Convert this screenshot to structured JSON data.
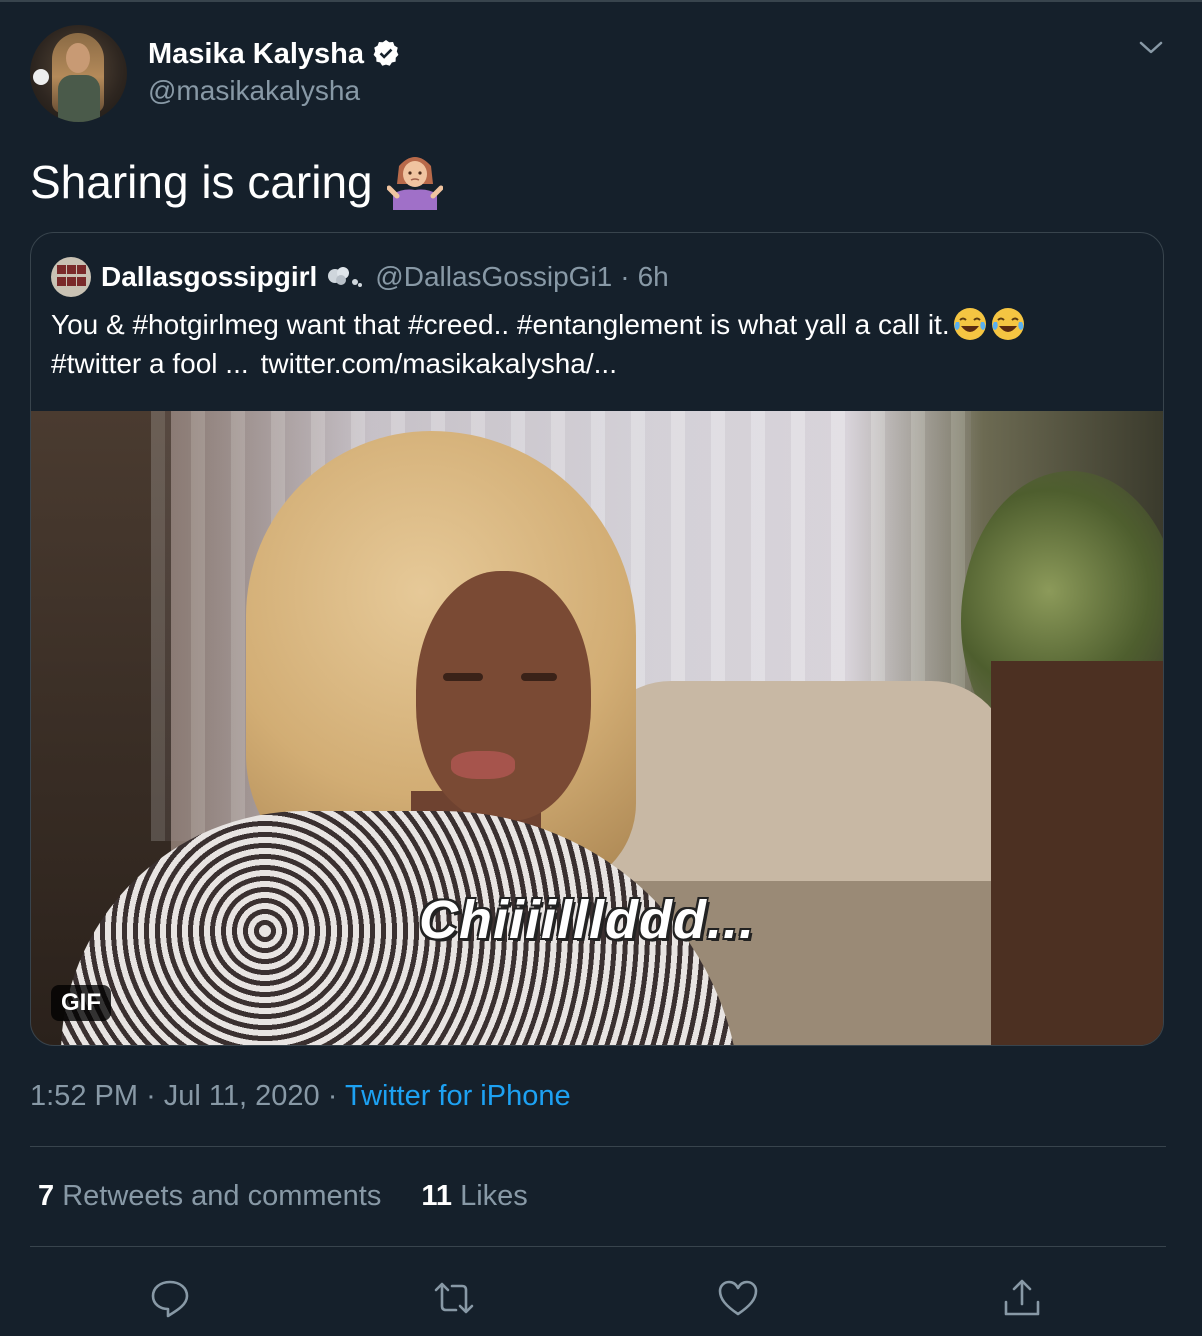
{
  "author": {
    "name": "Masika Kalysha",
    "handle": "@masikakalysha",
    "verified": true
  },
  "tweet": {
    "text": "Sharing is caring",
    "emoji": "person-shrugging"
  },
  "quoted": {
    "name": "Dallasgossipgirl",
    "handle": "@DallasGossipGi1",
    "separator": "·",
    "time": "6h",
    "text_line1": "You & #hotgirlmeg want that #creed.. #entanglement is what yall a call it.",
    "text_line2_a": "#twitter a fool ...",
    "text_line2_b": "twitter.com/masikakalysha/...",
    "media": {
      "caption": "Chiiiilllddd...",
      "badge": "GIF"
    }
  },
  "meta": {
    "time": "1:52 PM",
    "sep1": "·",
    "date": "Jul 11, 2020",
    "sep2": "·",
    "source": "Twitter for iPhone"
  },
  "stats": {
    "retweets_count": "7",
    "retweets_label": "Retweets and comments",
    "likes_count": "11",
    "likes_label": "Likes"
  },
  "actions": [
    "reply-icon",
    "retweet-icon",
    "like-icon",
    "share-icon"
  ],
  "colors": {
    "background": "#15202b",
    "text_secondary": "#8899a6",
    "link": "#1da1f2",
    "border": "#38444d"
  }
}
